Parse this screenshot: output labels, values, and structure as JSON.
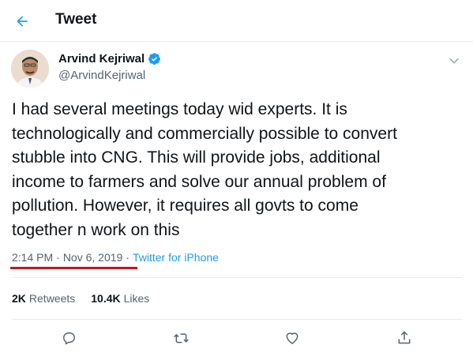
{
  "header": {
    "title": "Tweet",
    "back_icon": "arrow-left-icon",
    "accent": "#1d9bf0"
  },
  "author": {
    "name": "Arvind Kejriwal",
    "handle": "@ArvindKejriwal",
    "verified": true,
    "verified_icon": "verified-badge-icon"
  },
  "tweet": {
    "text": "I had several meetings today wid experts. It is\ntechnologically and commercially possible to convert\nstubble into CNG. This will provide jobs, additional\nincome to farmers and solve our annual problem of\npollution. However, it requires all govts to come\ntogether n work on this",
    "time": "2:14 PM",
    "date": "Nov 6, 2019",
    "separator": "·",
    "source": "Twitter for iPhone"
  },
  "stats": {
    "retweets_count": "2K",
    "retweets_label": "Retweets",
    "likes_count": "10.4K",
    "likes_label": "Likes"
  },
  "actions": [
    "reply-icon",
    "retweet-icon",
    "like-icon",
    "share-icon"
  ],
  "colors": {
    "text": "#0f1419",
    "muted": "#536471",
    "link": "#1d9bf0",
    "annotation_underline": "#c7141c"
  }
}
